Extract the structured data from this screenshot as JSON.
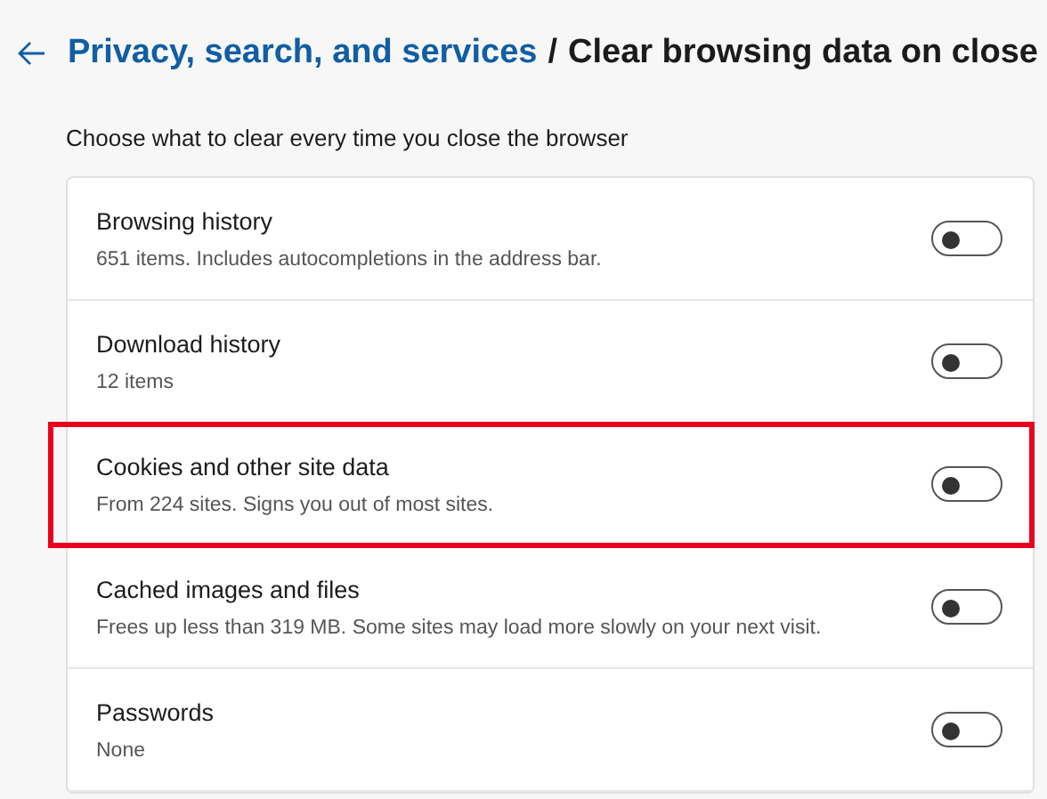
{
  "header": {
    "breadcrumb_link": "Privacy, search, and services",
    "separator": "/",
    "title": "Clear browsing data on close"
  },
  "description": "Choose what to clear every time you close the browser",
  "items": [
    {
      "name": "Browsing history",
      "detail": "651 items. Includes autocompletions in the address bar.",
      "on": false,
      "highlighted": false
    },
    {
      "name": "Download history",
      "detail": "12 items",
      "on": false,
      "highlighted": false
    },
    {
      "name": "Cookies and other site data",
      "detail": "From 224 sites. Signs you out of most sites.",
      "on": false,
      "highlighted": true
    },
    {
      "name": "Cached images and files",
      "detail": "Frees up less than 319 MB. Some sites may load more slowly on your next visit.",
      "on": false,
      "highlighted": false
    },
    {
      "name": "Passwords",
      "detail": "None",
      "on": false,
      "highlighted": false
    }
  ]
}
